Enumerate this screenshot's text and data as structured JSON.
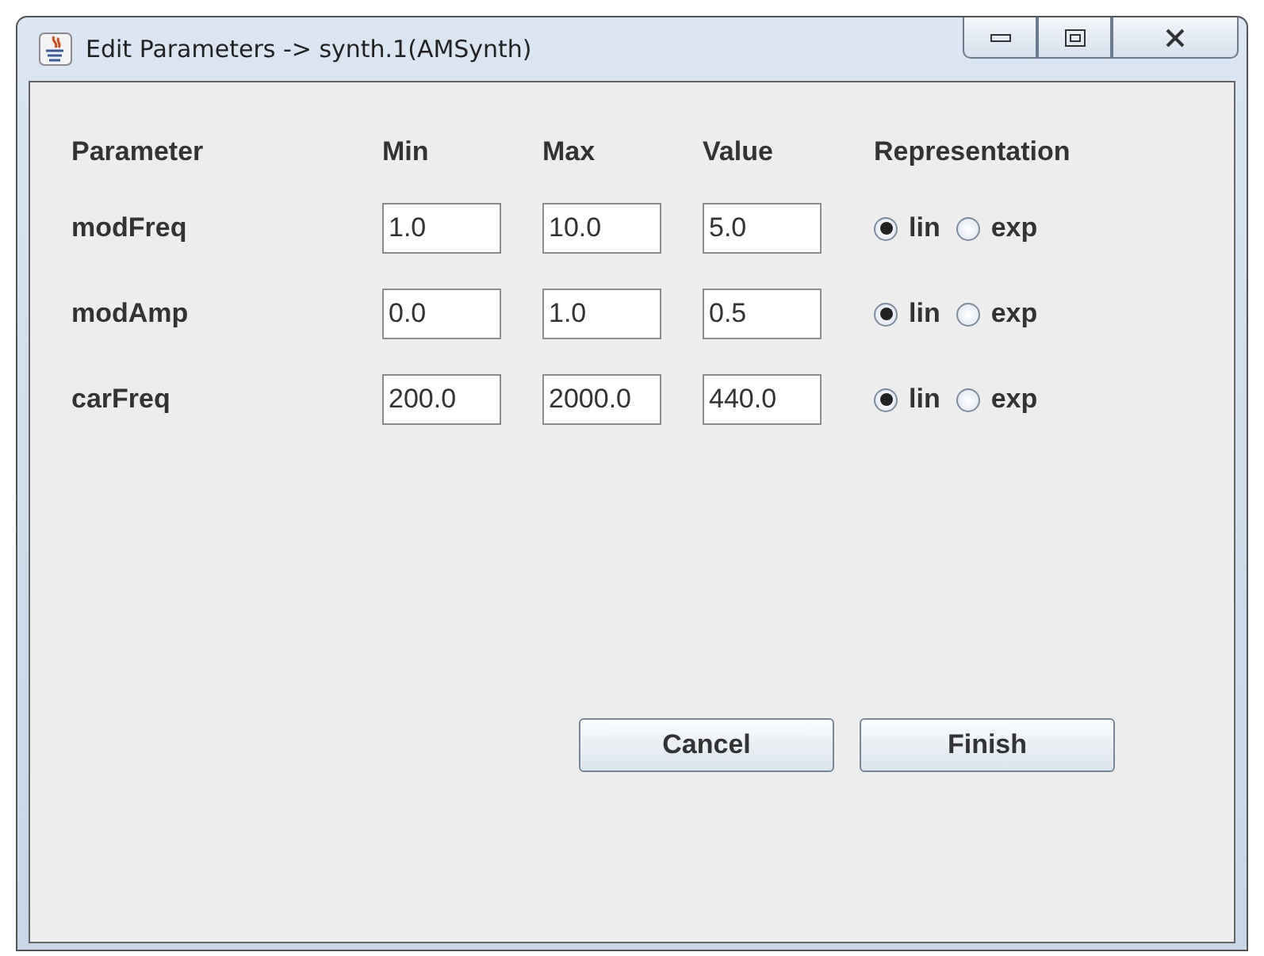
{
  "window": {
    "title": "Edit Parameters -> synth.1(AMSynth)"
  },
  "columns": [
    "Parameter",
    "Min",
    "Max",
    "Value",
    "Representation"
  ],
  "rows": [
    {
      "name": "modFreq",
      "min": "1.0",
      "max": "10.0",
      "value": "5.0",
      "representation": [
        {
          "label": "lin",
          "selected": true
        },
        {
          "label": "exp",
          "selected": false
        }
      ]
    },
    {
      "name": "modAmp",
      "min": "0.0",
      "max": "1.0",
      "value": "0.5",
      "representation": [
        {
          "label": "lin",
          "selected": true
        },
        {
          "label": "exp",
          "selected": false
        }
      ]
    },
    {
      "name": "carFreq",
      "min": "200.0",
      "max": "2000.0",
      "value": "440.0",
      "representation": [
        {
          "label": "lin",
          "selected": true
        },
        {
          "label": "exp",
          "selected": false
        }
      ]
    }
  ],
  "buttons": [
    "Cancel",
    "Finish"
  ]
}
